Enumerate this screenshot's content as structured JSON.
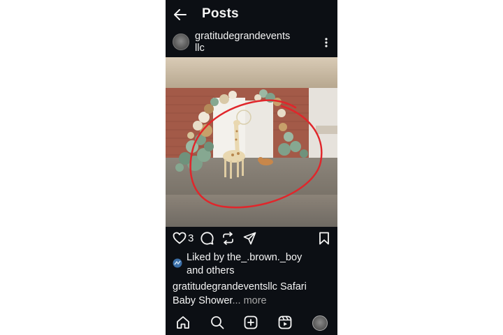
{
  "header": {
    "title": "Posts",
    "back_icon": "arrow-left-icon"
  },
  "post": {
    "username_line1": "gratitudegrandevents",
    "username_line2": "llc",
    "menu_icon": "more-vertical-icon",
    "image_alt": "Safari baby shower balloon arch with giraffe",
    "like_count": "3",
    "liked_by_prefix": "Liked by ",
    "liked_by_user": "the_.brown._boy",
    "liked_by_suffix": "and others",
    "caption_user": "gratitudegrandeventsllc",
    "caption_text_1": " Safari",
    "caption_text_2": "Baby Shower",
    "caption_ellipsis": "...",
    "caption_more": " more"
  },
  "bottom_nav": [
    "home-icon",
    "search-icon",
    "create-icon",
    "reels-icon",
    "profile-avatar"
  ],
  "colors": {
    "background": "#0c0f14",
    "text": "#f5f5f5",
    "muted": "#a8a8a8",
    "annotation": "#e0262b"
  }
}
